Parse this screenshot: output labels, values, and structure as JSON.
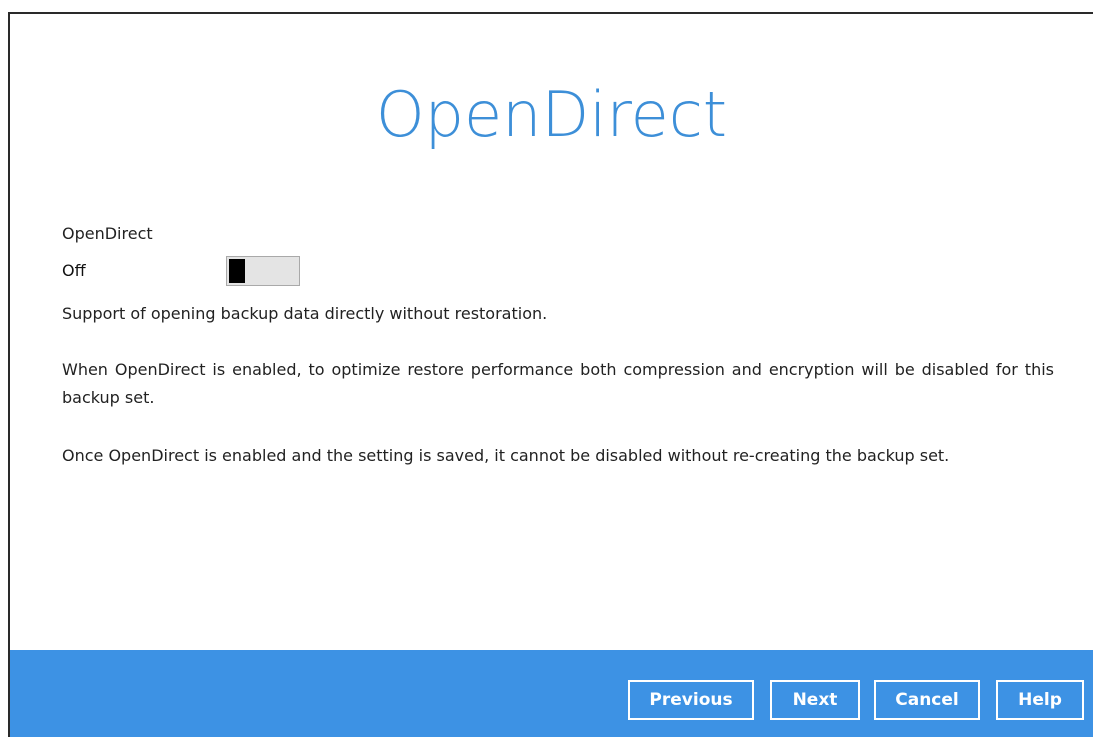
{
  "header": {
    "title": "OpenDirect"
  },
  "opendirect": {
    "label": "OpenDirect",
    "state_label": "Off",
    "enabled": false
  },
  "description": {
    "line1": "Support of opening backup data directly without restoration.",
    "line2": "When OpenDirect is enabled, to optimize restore performance both compression and encryption will be disabled for this backup set.",
    "line3": "Once OpenDirect is enabled and the setting is saved, it cannot be disabled without re-creating the backup set."
  },
  "footer": {
    "previous_label": "Previous",
    "next_label": "Next",
    "cancel_label": "Cancel",
    "help_label": "Help"
  },
  "colors": {
    "accent": "#3d8fd8",
    "footer_bg": "#3d92e4"
  }
}
